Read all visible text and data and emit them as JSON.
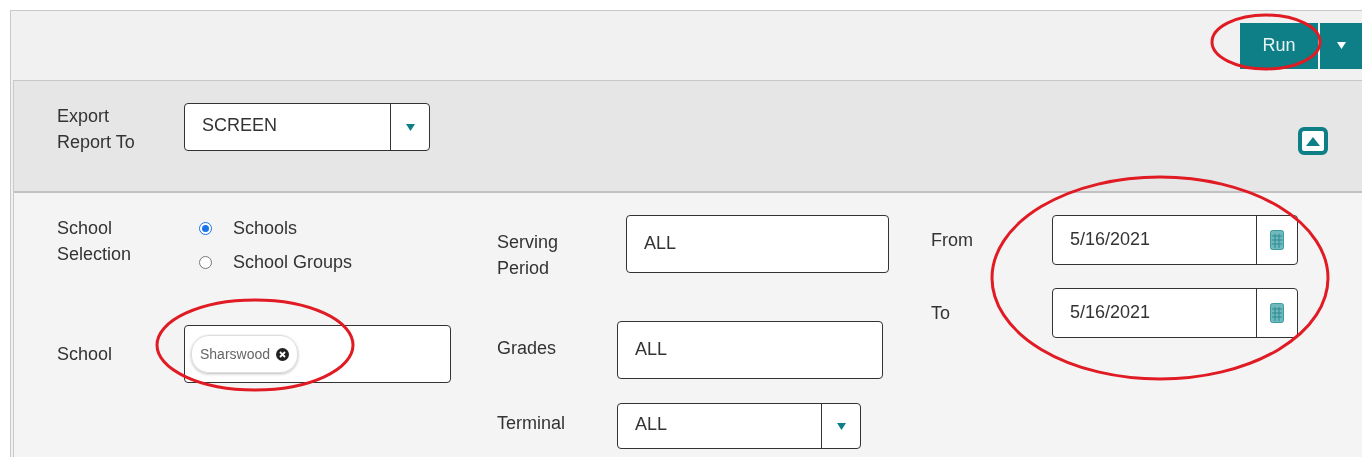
{
  "toolbar": {
    "run_button": "Run"
  },
  "export": {
    "label": "Export Report To",
    "value": "SCREEN",
    "expanded": true
  },
  "school_selection": {
    "label": "School Selection",
    "options": [
      {
        "label": "Schools",
        "selected": true
      },
      {
        "label": "School Groups",
        "selected": false
      }
    ]
  },
  "school": {
    "label": "School",
    "tags": [
      "Sharswood"
    ]
  },
  "serving_period": {
    "label": "Serving Period",
    "value": "ALL"
  },
  "grades": {
    "label": "Grades",
    "value": "ALL"
  },
  "terminal": {
    "label": "Terminal",
    "value": "ALL"
  },
  "from": {
    "label": "From",
    "value": "5/16/2021"
  },
  "to": {
    "label": "To",
    "value": "5/16/2021"
  }
}
